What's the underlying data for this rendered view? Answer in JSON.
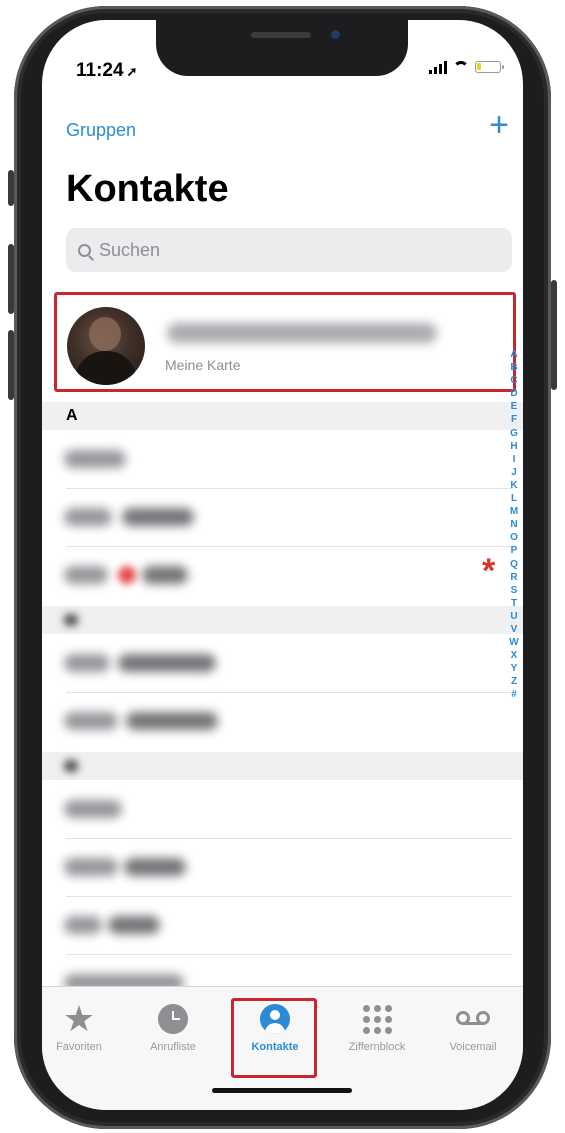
{
  "status": {
    "time": "11:24"
  },
  "nav": {
    "groups_label": "Gruppen",
    "add_label": "+"
  },
  "title": "Kontakte",
  "search": {
    "placeholder": "Suchen"
  },
  "my_card": {
    "subtitle": "Meine Karte"
  },
  "sections": [
    {
      "label": "A"
    }
  ],
  "index_letters": [
    "A",
    "B",
    "C",
    "D",
    "E",
    "F",
    "G",
    "H",
    "I",
    "J",
    "K",
    "L",
    "M",
    "N",
    "O",
    "P",
    "Q",
    "R",
    "S",
    "T",
    "U",
    "V",
    "W",
    "X",
    "Y",
    "Z",
    "#"
  ],
  "annotation": {
    "marker": "*"
  },
  "tabs": [
    {
      "label": "Favoriten",
      "icon": "star-icon",
      "active": false
    },
    {
      "label": "Anrufliste",
      "icon": "clock-icon",
      "active": false
    },
    {
      "label": "Kontakte",
      "icon": "person-circle-icon",
      "active": true
    },
    {
      "label": "Ziffernblock",
      "icon": "keypad-icon",
      "active": false
    },
    {
      "label": "Voicemail",
      "icon": "voicemail-icon",
      "active": false
    }
  ],
  "colors": {
    "accent": "#2b8bd6",
    "highlight": "#c9262d",
    "marker": "#d8352b"
  }
}
